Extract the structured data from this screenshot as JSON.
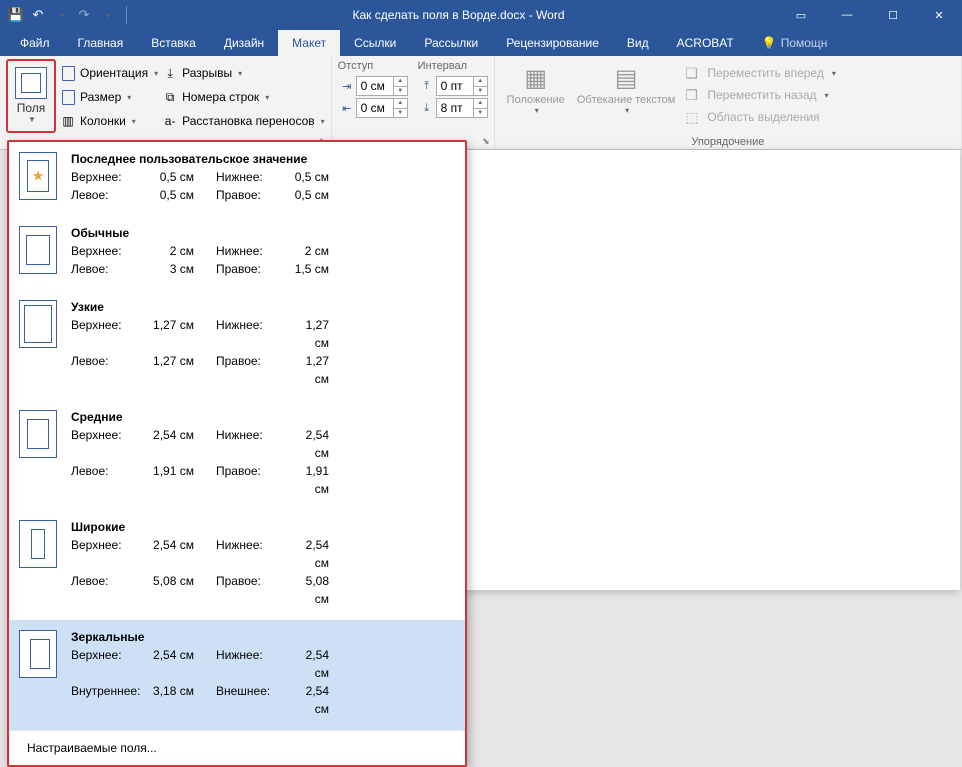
{
  "title": "Как сделать поля в Ворде.docx - Word",
  "tabs": {
    "file": "Файл",
    "home": "Главная",
    "insert": "Вставка",
    "design": "Дизайн",
    "layout": "Макет",
    "references": "Ссылки",
    "mailings": "Рассылки",
    "review": "Рецензирование",
    "view": "Вид",
    "acrobat": "ACROBAT",
    "tell": "Помощн"
  },
  "pagesetup": {
    "margins": "Поля",
    "orientation": "Ориентация",
    "size": "Размер",
    "columns": "Колонки",
    "breaks": "Разрывы",
    "linenumbers": "Номера строк",
    "hyphenation": "Расстановка переносов"
  },
  "paragraph": {
    "indent_label": "Отступ",
    "spacing_label": "Интервал",
    "indent_left": "0 см",
    "indent_right": "0 см",
    "space_before": "0 пт",
    "space_after": "8 пт"
  },
  "arrange": {
    "position": "Положение",
    "wrap": "Обтекание текстом",
    "forward": "Переместить вперед",
    "backward": "Переместить назад",
    "selection": "Область выделения",
    "group_label": "Упорядочение"
  },
  "margins_menu": {
    "labels": {
      "top": "Верхнее:",
      "bottom": "Нижнее:",
      "left": "Левое:",
      "right": "Правое:",
      "inner": "Внутреннее:",
      "outer": "Внешнее:"
    },
    "presets": [
      {
        "name": "Последнее пользовательское значение",
        "icon": "last",
        "top": "0,5 см",
        "bottom": "0,5 см",
        "left": "0,5 см",
        "right": "0,5 см"
      },
      {
        "name": "Обычные",
        "icon": "normal",
        "top": "2 см",
        "bottom": "2 см",
        "left": "3 см",
        "right": "1,5 см"
      },
      {
        "name": "Узкие",
        "icon": "narrow",
        "top": "1,27 см",
        "bottom": "1,27 см",
        "left": "1,27 см",
        "right": "1,27 см"
      },
      {
        "name": "Средние",
        "icon": "medium",
        "top": "2,54 см",
        "bottom": "2,54 см",
        "left": "1,91 см",
        "right": "1,91 см"
      },
      {
        "name": "Широкие",
        "icon": "wide",
        "top": "2,54 см",
        "bottom": "2,54 см",
        "left": "5,08 см",
        "right": "5,08 см"
      },
      {
        "name": "Зеркальные",
        "icon": "mirror",
        "mirror": true,
        "top": "2,54 см",
        "bottom": "2,54 см",
        "inner": "3,18 см",
        "outer": "2,54 см",
        "selected": true
      }
    ],
    "custom": "Настраиваемые поля..."
  }
}
